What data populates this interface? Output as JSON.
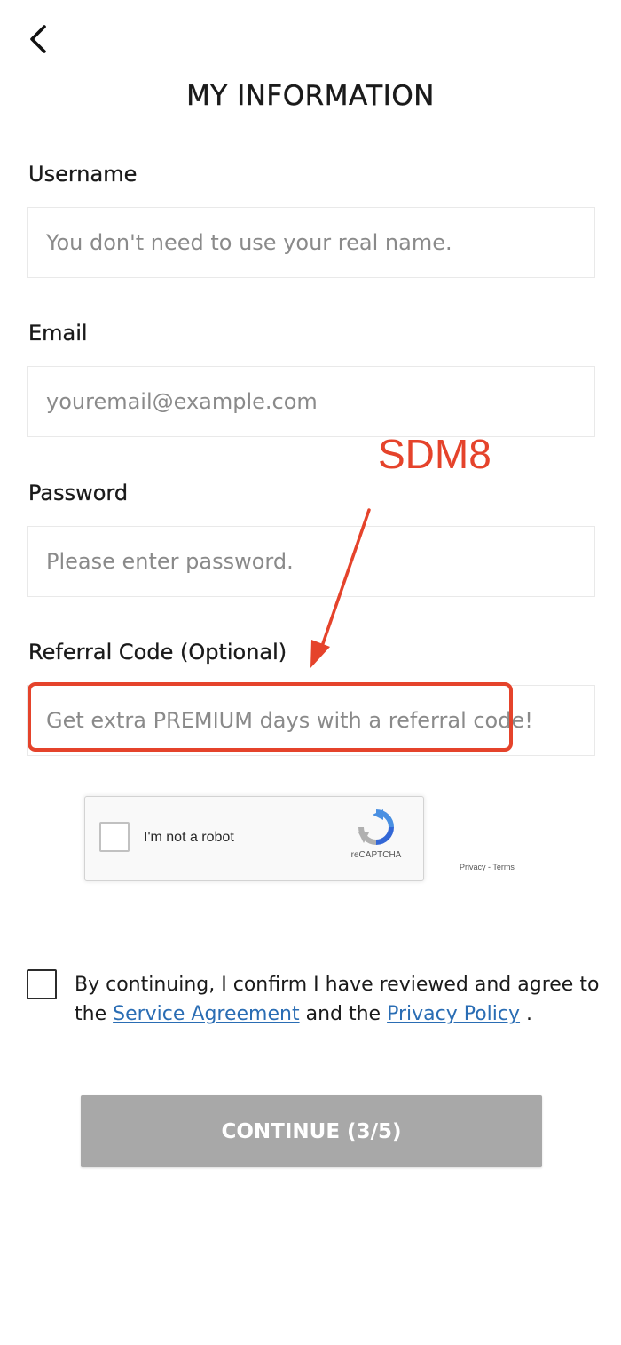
{
  "header": {
    "back_icon": "chevron-left-icon",
    "title": "MY INFORMATION"
  },
  "form": {
    "username": {
      "label": "Username",
      "value": "",
      "placeholder": "You don't need to use your real name."
    },
    "email": {
      "label": "Email",
      "value": "",
      "placeholder": "youremail@example.com"
    },
    "password": {
      "label": "Password",
      "value": "",
      "placeholder": "Please enter password."
    },
    "referral": {
      "label": "Referral Code (Optional)",
      "value": "",
      "placeholder": "Get extra PREMIUM days with a referral code!"
    }
  },
  "annotation": {
    "text": "SDM8",
    "color": "#e5432b"
  },
  "captcha": {
    "label": "I'm not a robot",
    "brand": "reCAPTCHA",
    "privacy": "Privacy",
    "separator": "-",
    "terms": "Terms",
    "checked": false
  },
  "agreement": {
    "checked": false,
    "text_before": "By continuing, I confirm I have reviewed and agree to the",
    "service_link": "Service Agreement",
    "text_middle": "and the",
    "privacy_link": "Privacy Policy",
    "text_after": ".",
    "link_color": "#2a6db4"
  },
  "continue_button": {
    "label": "CONTINUE (3/5)",
    "background": "#a8a8a8"
  }
}
